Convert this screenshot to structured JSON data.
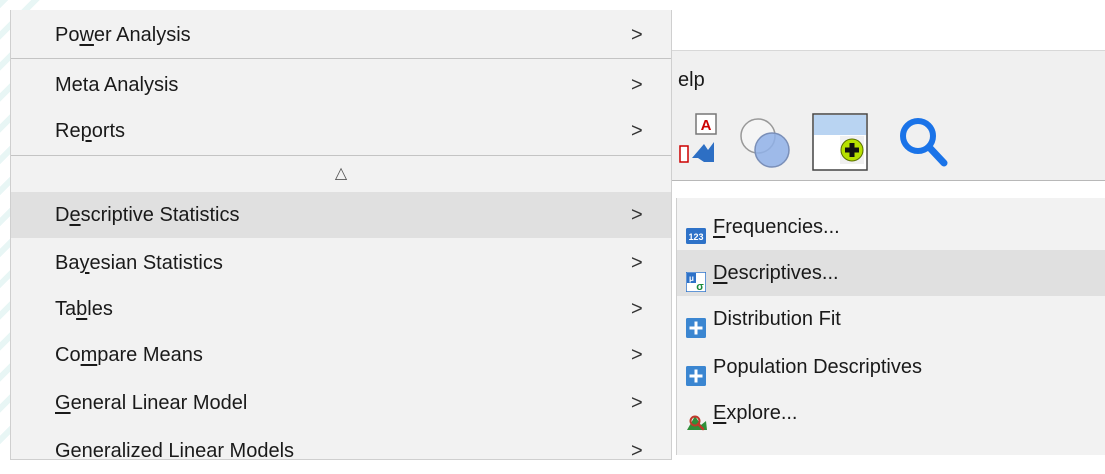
{
  "app": {
    "menubar_partial_label": "elp"
  },
  "main_menu": {
    "items": [
      {
        "pre": "Po",
        "acc": "w",
        "post": "er Analysis",
        "arrow": ">"
      },
      {
        "pre": "Meta Analysis",
        "acc": "",
        "post": "",
        "arrow": ">"
      },
      {
        "pre": "Re",
        "acc": "p",
        "post": "orts",
        "arrow": ">"
      },
      {
        "pre": "D",
        "acc": "e",
        "post": "scriptive Statistics",
        "arrow": ">"
      },
      {
        "pre": "Ba",
        "acc": "y",
        "post": "esian Statistics",
        "arrow": ">"
      },
      {
        "pre": "Ta",
        "acc": "b",
        "post": "les",
        "arrow": ">"
      },
      {
        "pre": "Co",
        "acc": "m",
        "post": "pare Means",
        "arrow": ">"
      },
      {
        "pre": "",
        "acc": "G",
        "post": "eneral Linear Model",
        "arrow": ">"
      },
      {
        "pre": "Generalized Linear Models",
        "acc": "",
        "post": "",
        "arrow": ">"
      }
    ],
    "scroll_up_glyph": "△"
  },
  "sub_menu": {
    "items": [
      {
        "pre": "",
        "acc": "F",
        "post": "requencies...",
        "icon": "frequencies-icon"
      },
      {
        "pre": "",
        "acc": "D",
        "post": "escriptives...",
        "icon": "descriptives-icon"
      },
      {
        "pre": "Distribution Fit",
        "acc": "",
        "post": "",
        "icon": "plus-extension-icon"
      },
      {
        "pre": "Population Descriptives",
        "acc": "",
        "post": "",
        "icon": "plus-extension-icon"
      },
      {
        "pre": "",
        "acc": "E",
        "post": "xplore...",
        "icon": "explore-icon"
      }
    ]
  },
  "colors": {
    "menu_bg": "#f2f2f2",
    "highlight": "#e0e0e0",
    "search_blue": "#1a73e8",
    "icon_blue": "#1f6fbf",
    "green": "#b6e000"
  }
}
